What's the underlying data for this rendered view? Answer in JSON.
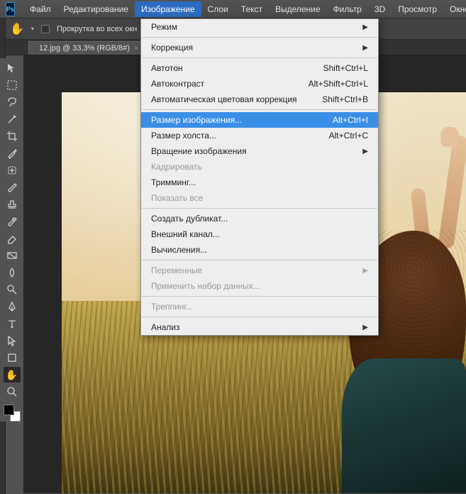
{
  "app": {
    "logo": "Ps"
  },
  "menubar": {
    "items": [
      "Файл",
      "Редактирование",
      "Изображение",
      "Слои",
      "Текст",
      "Выделение",
      "Фильтр",
      "3D",
      "Просмотр",
      "Окно"
    ],
    "open_index": 2
  },
  "optbar": {
    "scroll_label": "Прокрутка во всех окн"
  },
  "document": {
    "tab_label": "12.jpg @ 33,3% (RGB/8#)",
    "close": "×"
  },
  "dropdown": {
    "rows": [
      {
        "label": "Режим",
        "shortcut": "",
        "arrow": true,
        "disabled": false
      },
      {
        "sep": true
      },
      {
        "label": "Коррекция",
        "shortcut": "",
        "arrow": true,
        "disabled": false
      },
      {
        "sep": true
      },
      {
        "label": "Автотон",
        "shortcut": "Shift+Ctrl+L",
        "arrow": false,
        "disabled": false
      },
      {
        "label": "Автоконтраст",
        "shortcut": "Alt+Shift+Ctrl+L",
        "arrow": false,
        "disabled": false
      },
      {
        "label": "Автоматическая цветовая коррекция",
        "shortcut": "Shift+Ctrl+B",
        "arrow": false,
        "disabled": false
      },
      {
        "sep": true
      },
      {
        "label": "Размер изображения...",
        "shortcut": "Alt+Ctrl+I",
        "arrow": false,
        "disabled": false,
        "highlight": true
      },
      {
        "label": "Размер холста...",
        "shortcut": "Alt+Ctrl+C",
        "arrow": false,
        "disabled": false
      },
      {
        "label": "Вращение изображения",
        "shortcut": "",
        "arrow": true,
        "disabled": false
      },
      {
        "label": "Кадрировать",
        "shortcut": "",
        "arrow": false,
        "disabled": true
      },
      {
        "label": "Тримминг...",
        "shortcut": "",
        "arrow": false,
        "disabled": false
      },
      {
        "label": "Показать все",
        "shortcut": "",
        "arrow": false,
        "disabled": true
      },
      {
        "sep": true
      },
      {
        "label": "Создать дубликат...",
        "shortcut": "",
        "arrow": false,
        "disabled": false
      },
      {
        "label": "Внешний канал...",
        "shortcut": "",
        "arrow": false,
        "disabled": false
      },
      {
        "label": "Вычисления...",
        "shortcut": "",
        "arrow": false,
        "disabled": false
      },
      {
        "sep": true
      },
      {
        "label": "Переменные",
        "shortcut": "",
        "arrow": true,
        "disabled": true
      },
      {
        "label": "Применить набор данных...",
        "shortcut": "",
        "arrow": false,
        "disabled": true
      },
      {
        "sep": true
      },
      {
        "label": "Треппинг...",
        "shortcut": "",
        "arrow": false,
        "disabled": true
      },
      {
        "sep": true
      },
      {
        "label": "Анализ",
        "shortcut": "",
        "arrow": true,
        "disabled": false
      }
    ]
  },
  "tools": {
    "names": [
      "move",
      "marquee",
      "lasso",
      "magic-wand",
      "crop",
      "eyedropper",
      "healing",
      "brush",
      "stamp",
      "history-brush",
      "eraser",
      "gradient",
      "blur",
      "dodge",
      "pen",
      "type",
      "path-select",
      "shape",
      "hand",
      "zoom"
    ],
    "selected": "hand"
  }
}
